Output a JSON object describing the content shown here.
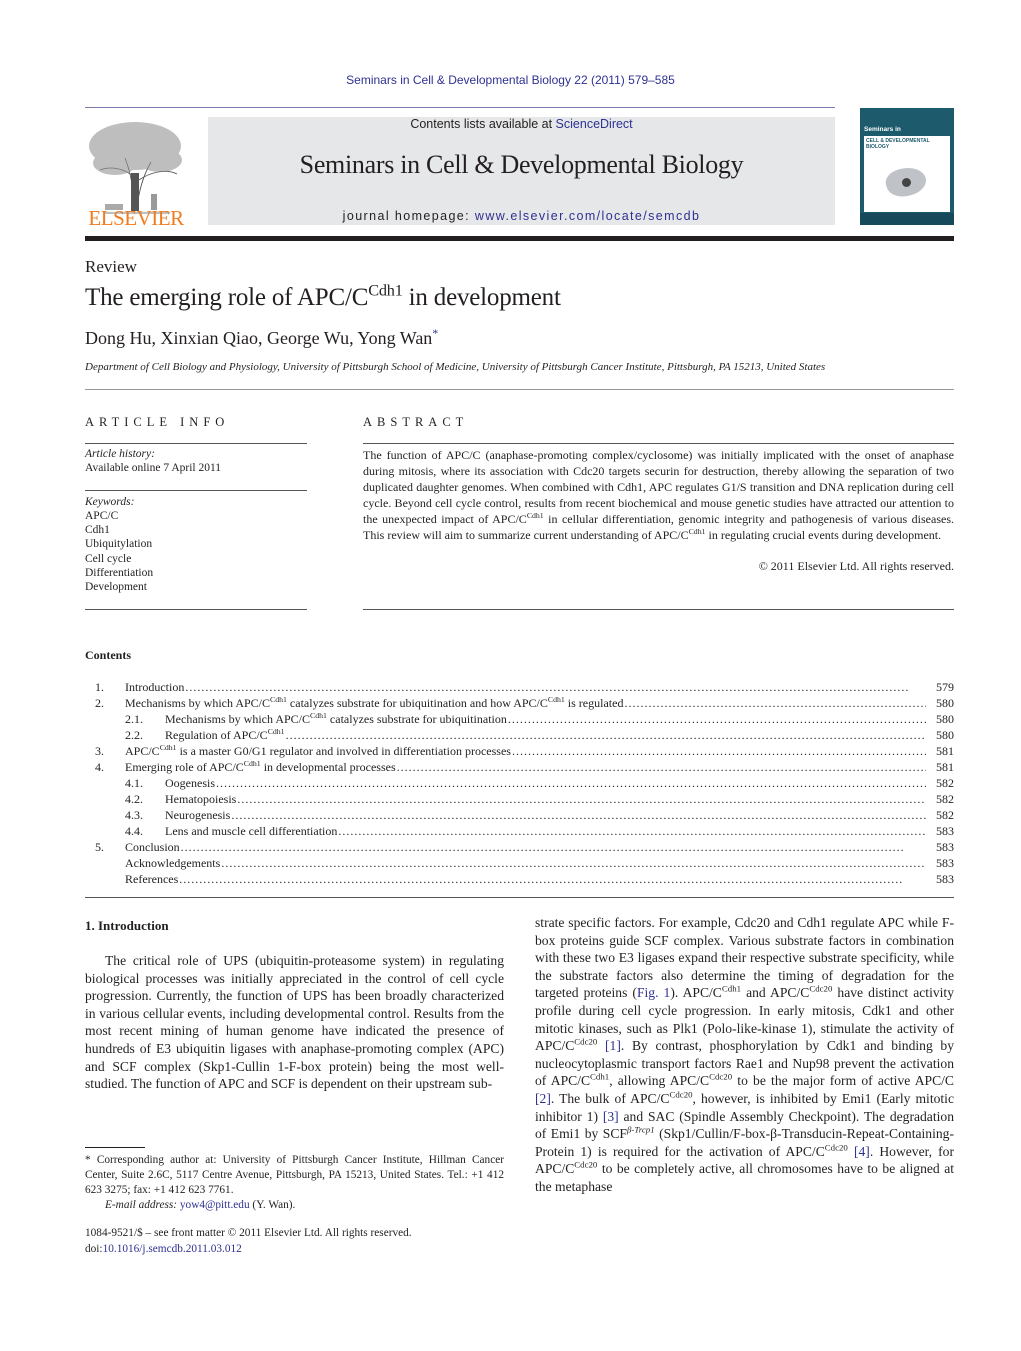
{
  "header": {
    "citation": "Seminars in Cell & Developmental Biology 22 (2011) 579–585",
    "publisher_logo_text": "ELSEVIER",
    "contents_available_prefix": "Contents lists available at ",
    "contents_available_link": "ScienceDirect",
    "journal_title": "Seminars in Cell & Developmental Biology",
    "homepage_prefix": "journal homepage: ",
    "homepage_url": "www.elsevier.com/locate/semcdb",
    "cover": {
      "line1": "Seminars in",
      "line2": "CELL & DEVELOPMENTAL BIOLOGY",
      "accent_color": "#1d5a6b"
    },
    "link_color": "#2e3192",
    "logo_color": "#f07c1f"
  },
  "article": {
    "type": "Review",
    "title_prefix": "The emerging role of APC/C",
    "title_sup": "Cdh1",
    "title_suffix": " in development",
    "authors": "Dong Hu, Xinxian Qiao, George Wu, Yong Wan",
    "author_mark": "*",
    "affiliation": "Department of Cell Biology and Physiology, University of Pittsburgh School of Medicine, University of Pittsburgh Cancer Institute, Pittsburgh, PA 15213, United States"
  },
  "article_info": {
    "heading": "ARTICLE INFO",
    "history_label": "Article history:",
    "history_value": "Available online 7 April 2011",
    "keywords_label": "Keywords:",
    "keywords": [
      "APC/C",
      "Cdh1",
      "Ubiquitylation",
      "Cell cycle",
      "Differentiation",
      "Development"
    ]
  },
  "abstract": {
    "heading": "ABSTRACT",
    "p1": "The function of APC/C (anaphase-promoting complex/cyclosome) was initially implicated with the onset of anaphase during mitosis, where its association with Cdc20 targets securin for destruction, thereby allowing the separation of two duplicated daughter genomes. When combined with Cdh1, APC regulates G1/S transition and DNA replication during cell cycle. Beyond cell cycle control, results from recent biochemical and mouse genetic studies have attracted our attention to the unexpected impact of APC/C",
    "sup1": "Cdh1",
    "p2": " in cellular differentiation, genomic integrity and pathogenesis of various diseases. This review will aim to summarize current understanding of APC/C",
    "sup2": "Cdh1",
    "p3": " in regulating crucial events during development.",
    "copyright": "© 2011 Elsevier Ltd. All rights reserved."
  },
  "contents": {
    "heading": "Contents",
    "items": [
      {
        "num": "1.",
        "pre": "Introduction",
        "sup": "",
        "post": "",
        "page": "579",
        "level": 1
      },
      {
        "num": "2.",
        "pre": "Mechanisms by which APC/C",
        "sup": "Cdh1",
        "post": " catalyzes substrate for ubiquitination and how APC/C",
        "sup2": "Cdh1",
        "post2": " is regulated",
        "page": "580",
        "level": 1
      },
      {
        "num": "2.1.",
        "pre": "Mechanisms by which APC/C",
        "sup": "Cdh1",
        "post": " catalyzes substrate for ubiquitination",
        "page": "580",
        "level": 2
      },
      {
        "num": "2.2.",
        "pre": "Regulation of APC/C",
        "sup": "Cdh1",
        "post": "",
        "page": "580",
        "level": 2
      },
      {
        "num": "3.",
        "pre": "APC/C",
        "sup": "Cdh1",
        "post": " is a master G0/G1 regulator and involved in differentiation processes",
        "page": "581",
        "level": 1
      },
      {
        "num": "4.",
        "pre": "Emerging role of APC/C",
        "sup": "Cdh1",
        "post": " in developmental processes",
        "page": "581",
        "level": 1
      },
      {
        "num": "4.1.",
        "pre": "Oogenesis",
        "sup": "",
        "post": "",
        "page": "582",
        "level": 2
      },
      {
        "num": "4.2.",
        "pre": "Hematopoiesis",
        "sup": "",
        "post": "",
        "page": "582",
        "level": 2
      },
      {
        "num": "4.3.",
        "pre": "Neurogenesis",
        "sup": "",
        "post": "",
        "page": "582",
        "level": 2
      },
      {
        "num": "4.4.",
        "pre": "Lens and muscle cell differentiation",
        "sup": "",
        "post": "",
        "page": "583",
        "level": 2
      },
      {
        "num": "5.",
        "pre": "Conclusion",
        "sup": "",
        "post": "",
        "page": "583",
        "level": 1
      },
      {
        "num": "",
        "pre": "Acknowledgements",
        "sup": "",
        "post": "",
        "page": "583",
        "level": 1
      },
      {
        "num": "",
        "pre": "References",
        "sup": "",
        "post": "",
        "page": "583",
        "level": 1
      }
    ]
  },
  "body": {
    "intro_heading": "1.  Introduction",
    "left_paragraph": "The critical role of UPS (ubiquitin-proteasome system) in regulating biological processes was initially appreciated in the control of cell cycle progression. Currently, the function of UPS has been broadly characterized in various cellular events, including developmental control. Results from the most recent mining of human genome have indicated the presence of hundreds of E3 ubiquitin ligases with anaphase-promoting complex (APC) and SCF complex (Skp1-Cullin 1-F-box protein) being the most well-studied. The function of APC and SCF is dependent on their upstream sub-",
    "right": {
      "s1": "strate specific factors. For example, Cdc20 and Cdh1 regulate APC while F-box proteins guide SCF complex. Various substrate factors in combination with these two E3 ligases expand their respective substrate specificity, while the substrate factors also determine the timing of degradation for the targeted proteins (",
      "fig_ref": "Fig. 1",
      "s2": "). APC/C",
      "sup_cdh1_a": "Cdh1",
      "s3": " and APC/C",
      "sup_cdc20_a": "Cdc20",
      "s4": " have distinct activity profile during cell cycle progression. In early mitosis, Cdk1 and other mitotic kinases, such as Plk1 (Polo-like-kinase 1), stimulate the activity of APC/C",
      "sup_cdc20_b": "Cdc20",
      "ref1": "[1]",
      "s5": ". By contrast, phosphorylation by Cdk1 and binding by nucleocytoplasmic transport factors Rae1 and Nup98 prevent the activation of APC/C",
      "sup_cdh1_b": "Cdh1",
      "s6": ", allowing APC/C",
      "sup_cdc20_c": "Cdc20",
      "s7": " to be the major form of active APC/C ",
      "ref2": "[2]",
      "s8": ". The bulk of APC/C",
      "sup_cdc20_d": "Cdc20",
      "s9": ", however, is inhibited by Emi1 (Early mitotic inhibitor 1) ",
      "ref3": "[3]",
      "s10": " and SAC (Spindle Assembly Checkpoint). The degradation of Emi1 by SCF",
      "sup_btrcp": "β-Trcp1",
      "s11": " (Skp1/Cullin/F-box-β-Transducin-Repeat-Containing-Protein 1) is required for the activation of APC/C",
      "sup_cdc20_e": "Cdc20",
      "ref4": "[4]",
      "s12": ". However, for APC/C",
      "sup_cdc20_f": "Cdc20",
      "s13": " to be completely active, all chromosomes have to be aligned at the metaphase"
    }
  },
  "footnote": {
    "corresponding": "* Corresponding author at: University of Pittsburgh Cancer Institute, Hillman Cancer Center, Suite 2.6C, 5117 Centre Avenue, Pittsburgh, PA 15213, United States. Tel.: +1 412 623 3275; fax: +1 412 623 7761.",
    "email_label": "E-mail address:",
    "email": "yow4@pitt.edu",
    "email_suffix": " (Y. Wan).",
    "front_matter": "1084-9521/$ – see front matter © 2011 Elsevier Ltd. All rights reserved.",
    "doi_prefix": "doi:",
    "doi": "10.1016/j.semcdb.2011.03.012"
  }
}
